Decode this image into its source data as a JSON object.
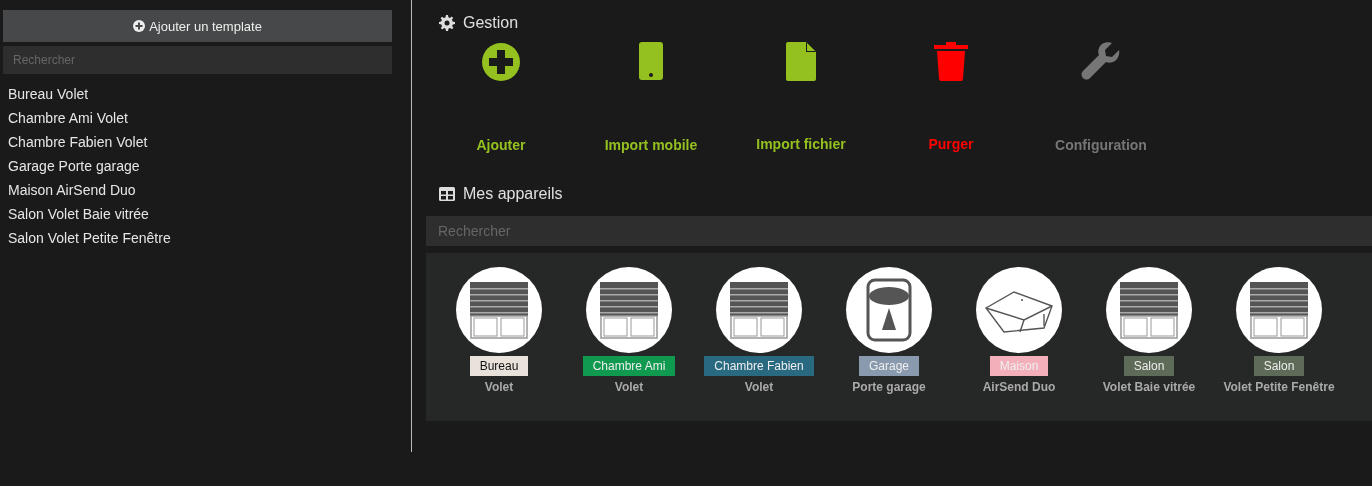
{
  "sidebar": {
    "add_button": "Ajouter un template",
    "search": {
      "placeholder": "Rechercher"
    },
    "items": [
      "Bureau Volet",
      "Chambre Ami Volet",
      "Chambre Fabien Volet",
      "Garage Porte garage",
      "Maison AirSend Duo",
      "Salon Volet Baie vitrée",
      "Salon Volet Petite Fenêtre"
    ]
  },
  "gestion": {
    "title": "Gestion",
    "actions": [
      {
        "kind": "add",
        "label": "Ajouter",
        "color": "#94c11f"
      },
      {
        "kind": "mobile",
        "label": "Import mobile",
        "color": "#94c11f"
      },
      {
        "kind": "file",
        "label": "Import fichier",
        "color": "#94c11f"
      },
      {
        "kind": "trash",
        "label": "Purger",
        "color": "#ff0000"
      },
      {
        "kind": "wrench",
        "label": "Configuration",
        "color": "#767676"
      }
    ]
  },
  "devices_section": {
    "title": "Mes appareils",
    "search": {
      "placeholder": "Rechercher"
    },
    "devices": [
      {
        "kind": "shutter",
        "room": "Bureau",
        "color": "#e8e2da",
        "name": "Volet"
      },
      {
        "kind": "shutter",
        "room": "Chambre Ami",
        "color": "#0f9a50",
        "name": "Volet"
      },
      {
        "kind": "shutter",
        "room": "Chambre Fabien",
        "color": "#2a6a80",
        "name": "Volet"
      },
      {
        "kind": "push",
        "room": "Garage",
        "color": "#8a9aae",
        "name": "Porte garage"
      },
      {
        "kind": "box",
        "room": "Maison",
        "color": "#f4b0ba",
        "name": "AirSend Duo"
      },
      {
        "kind": "shutter",
        "room": "Salon",
        "color": "#5d6b58",
        "name": "Volet Baie vitrée"
      },
      {
        "kind": "shutter",
        "room": "Salon",
        "color": "#5d6b58",
        "name": "Volet Petite Fenêtre"
      }
    ]
  }
}
